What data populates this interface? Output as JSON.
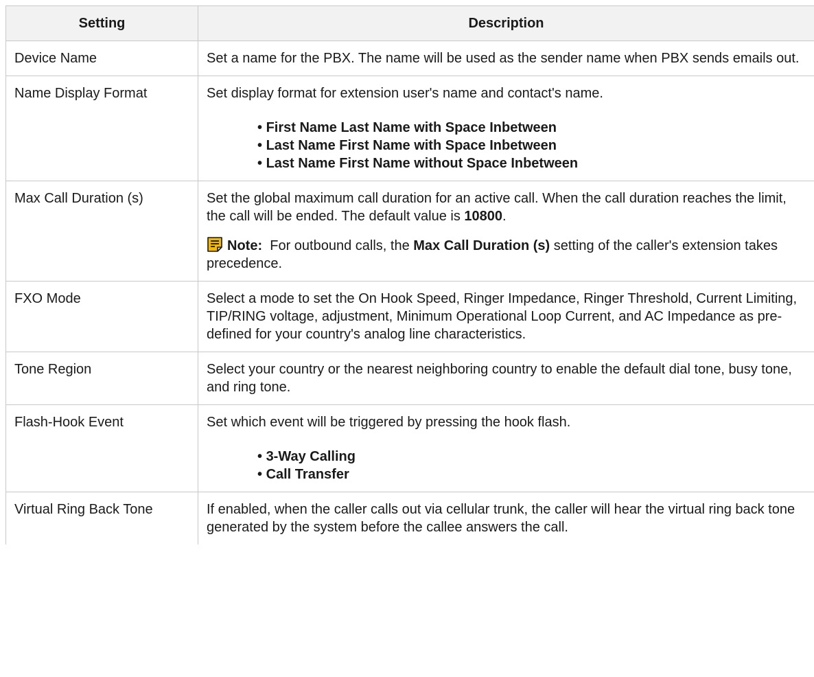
{
  "header": {
    "col_setting": "Setting",
    "col_description": "Description"
  },
  "rows": [
    {
      "setting": "Device Name",
      "description": "Set a name for the PBX. The name will be used as the sender name when PBX sends emails out."
    },
    {
      "setting": "Name Display Format",
      "description": "Set display format for extension user's name and contact's name.",
      "options": [
        "First Name Last Name with Space Inbetween",
        "Last Name First Name with Space Inbetween",
        "Last Name First Name without Space Inbetween"
      ]
    },
    {
      "setting": "Max Call Duration (s)",
      "description_before": "Set the global maximum call duration for an active call. When the call duration reaches the limit, the call will be ended. The default value is ",
      "description_bold": "10800",
      "description_after": ".",
      "note": {
        "label": "Note:",
        "text_before": "For outbound calls, the ",
        "text_bold": "Max Call Duration (s)",
        "text_after": " setting of the caller's extension takes precedence."
      }
    },
    {
      "setting": "FXO Mode",
      "description": "Select a mode to set the On Hook Speed, Ringer Impedance, Ringer Threshold, Current Limiting, TIP/RING voltage, adjustment, Minimum Operational Loop Current, and AC Impedance as pre-defined for your country's analog line characteristics."
    },
    {
      "setting": "Tone Region",
      "description": "Select your country or the nearest neighboring country to enable the default dial tone, busy tone, and ring tone."
    },
    {
      "setting": "Flash-Hook Event",
      "description": "Set which event will be triggered by pressing the hook flash.",
      "options": [
        "3-Way Calling",
        "Call Transfer"
      ]
    },
    {
      "setting": "Virtual Ring Back Tone",
      "description": "If enabled, when the caller calls out via cellular trunk, the caller will hear the virtual ring back tone generated by the system before the callee answers the call."
    }
  ],
  "colors": {
    "header_bg": "#f2f2f2",
    "border": "#c8c8c8",
    "note_icon": "#f5b800"
  },
  "icons": {
    "note": "note-icon"
  }
}
